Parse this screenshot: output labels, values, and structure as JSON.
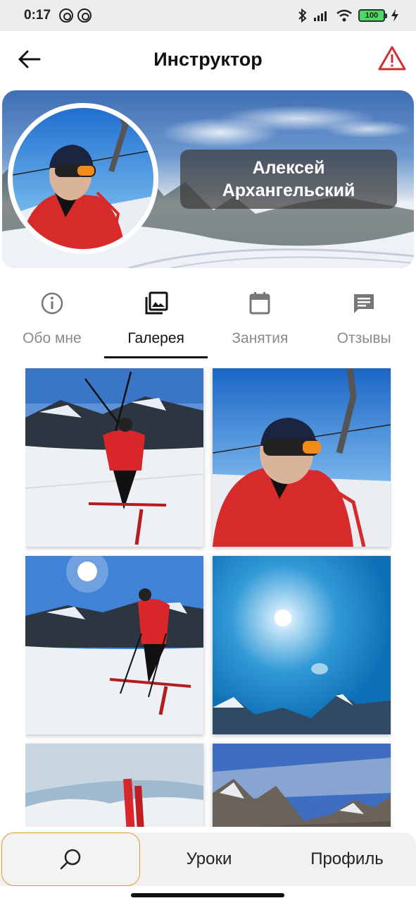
{
  "status_bar": {
    "time": "0:17",
    "battery": "100"
  },
  "header": {
    "title": "Инструктор",
    "icons": [
      "arrow-left-icon",
      "warning-icon"
    ]
  },
  "profile": {
    "first_name": "Алексей",
    "last_name": "Архангельский"
  },
  "tabs": [
    {
      "label": "Обо мне",
      "icon": "info-icon",
      "active": false
    },
    {
      "label": "Галерея",
      "icon": "gallery-icon",
      "active": true
    },
    {
      "label": "Занятия",
      "icon": "calendar-icon",
      "active": false
    },
    {
      "label": "Отзывы",
      "icon": "chat-icon",
      "active": false
    }
  ],
  "bottom_nav": {
    "search_icon": "search-icon",
    "lessons_label": "Уроки",
    "profile_label": "Профиль"
  },
  "colors": {
    "accent_border": "#e39a2c",
    "warning": "#d32f2f",
    "active_tab": "#111111",
    "inactive_tab": "#8a8a8a"
  }
}
